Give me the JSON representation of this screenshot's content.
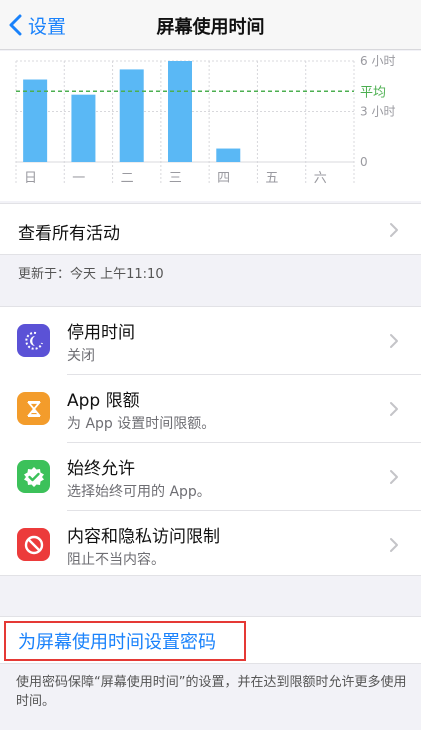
{
  "nav": {
    "back_label": "设置",
    "title": "屏幕使用时间"
  },
  "chart_data": {
    "type": "bar",
    "categories": [
      "日",
      "一",
      "二",
      "三",
      "四",
      "五",
      "六"
    ],
    "values": [
      4.9,
      4.0,
      5.5,
      6.0,
      0.8,
      0,
      0
    ],
    "y_labels": [
      "6 小时",
      "3 小时",
      "0"
    ],
    "ylim": [
      0,
      6
    ],
    "average": 4.2,
    "average_label": "平均",
    "bar_color": "#5ab8f5",
    "average_color": "#4caf50"
  },
  "activity": {
    "label": "查看所有活动"
  },
  "updated": "更新于：今天 上午11:10",
  "settings": [
    {
      "title": "停用时间",
      "subtitle": "关闭",
      "icon": "downtime-icon",
      "color": "#5b52d6"
    },
    {
      "title": "App 限额",
      "subtitle": "为 App 设置时间限额。",
      "icon": "hourglass-icon",
      "color": "#f39c2b"
    },
    {
      "title": "始终允许",
      "subtitle": "选择始终可用的 App。",
      "icon": "checkmark-badge-icon",
      "color": "#3cc15a"
    },
    {
      "title": "内容和隐私访问限制",
      "subtitle": "阻止不当内容。",
      "icon": "restriction-icon",
      "color": "#ec3b3b"
    }
  ],
  "passcode": {
    "label": "为屏幕使用时间设置密码"
  },
  "footnote": "使用密码保障“屏幕使用时间”的设置，并在达到限额时允许更多使用时间。"
}
